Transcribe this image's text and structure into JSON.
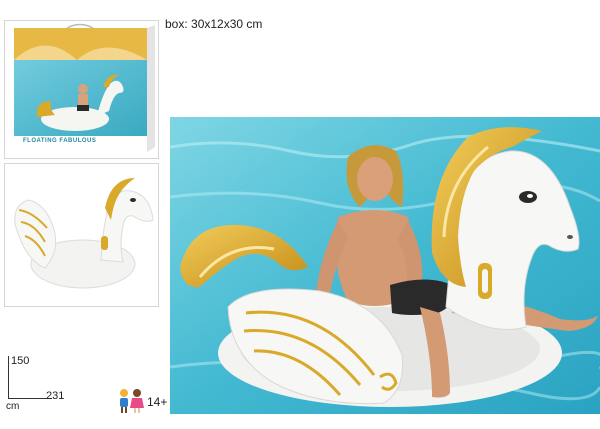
{
  "box": {
    "dimensions_text": "box: 30x12x30 cm",
    "brand_text": "FLOATING FABULOUS"
  },
  "size": {
    "height": "150",
    "width": "231",
    "unit": "cm"
  },
  "age": {
    "label": "14+",
    "icon": "children-icon"
  },
  "colors": {
    "water": "#4fc1d6",
    "gold": "#d9a92a",
    "float_white": "#f7f7f5"
  }
}
